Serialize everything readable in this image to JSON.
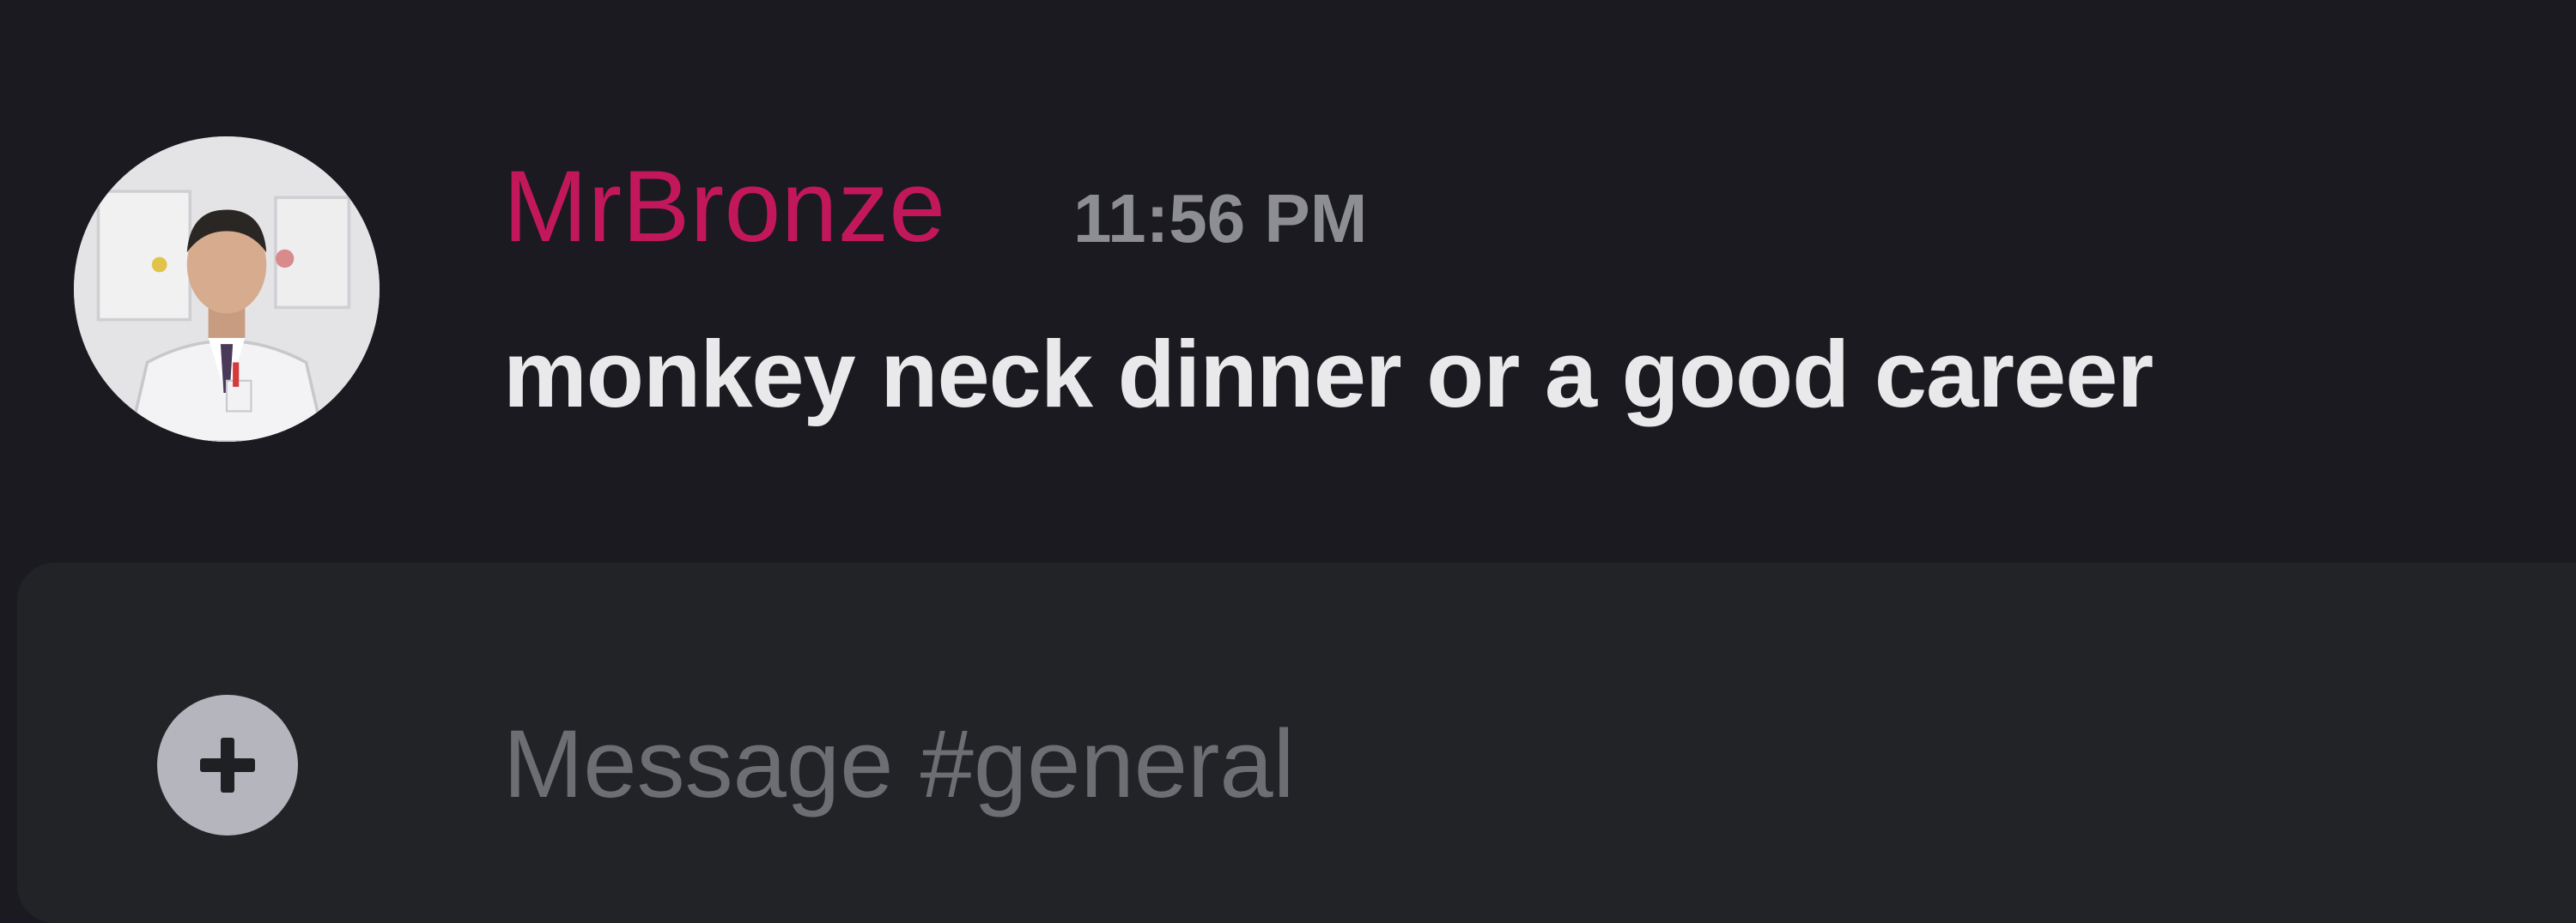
{
  "message": {
    "username": "MrBronze",
    "username_color": "#c2185b",
    "timestamp": "11:56 PM",
    "text": "monkey neck dinner or a good career",
    "avatar_icon": "user-avatar"
  },
  "composer": {
    "add_icon": "plus-circle-icon",
    "placeholder": "Message #general",
    "value": ""
  }
}
